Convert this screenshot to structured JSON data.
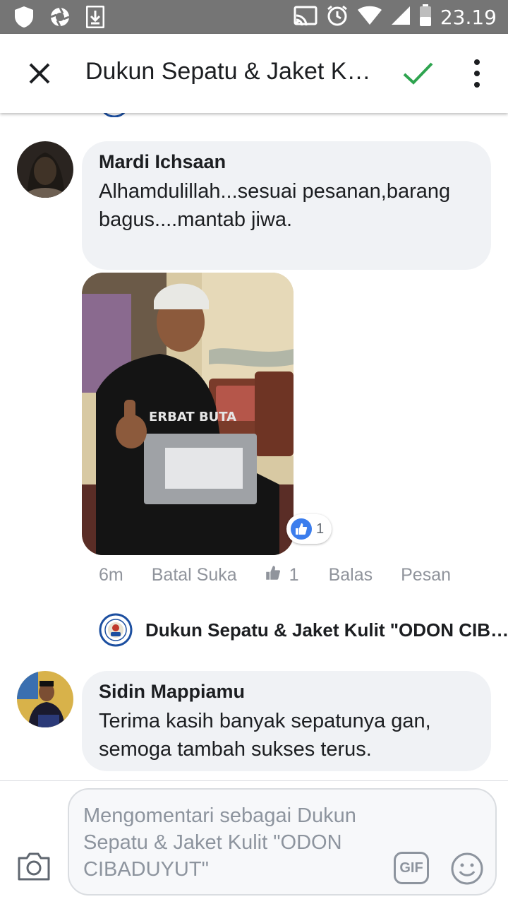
{
  "status_bar": {
    "time": "23.19",
    "left_icons": [
      "shield-icon",
      "aperture-icon",
      "download-icon"
    ],
    "right_icons": [
      "cast-icon",
      "alarm-icon",
      "wifi-icon",
      "signal-icon",
      "battery-icon"
    ]
  },
  "app_bar": {
    "title": "Dukun Sepatu & Jaket Kulit \"ODON CIBADUYUT\"",
    "close_icon": "close-icon",
    "confirm_icon": "check-icon",
    "more_icon": "more-vertical-icon"
  },
  "comments": [
    {
      "author": "Mardi Ichsaan",
      "text": "Alhamdulillah...sesuai pesanan,barang bagus....mantab jiwa.",
      "reaction_count": "1",
      "actions": {
        "time": "6m",
        "unlike": "Batal Suka",
        "like_count": "1",
        "reply": "Balas",
        "message": "Pesan"
      }
    },
    {
      "author": "Sidin Mappiamu",
      "text": "Terima kasih banyak sepatunya gan, semoga tambah sukses terus."
    }
  ],
  "page_reply": {
    "name": "Dukun Sepatu & Jaket Kulit \"ODON CIBADUYUT\""
  },
  "composer": {
    "placeholder": "Mengomentari sebagai Dukun Sepatu & Jaket Kulit \"ODON CIBADUYUT\"",
    "gif_label": "GIF"
  },
  "colors": {
    "status_bar": "#757575",
    "check": "#2ea44f",
    "like_blue": "#3b7ded",
    "bubble": "#f0f2f5"
  }
}
